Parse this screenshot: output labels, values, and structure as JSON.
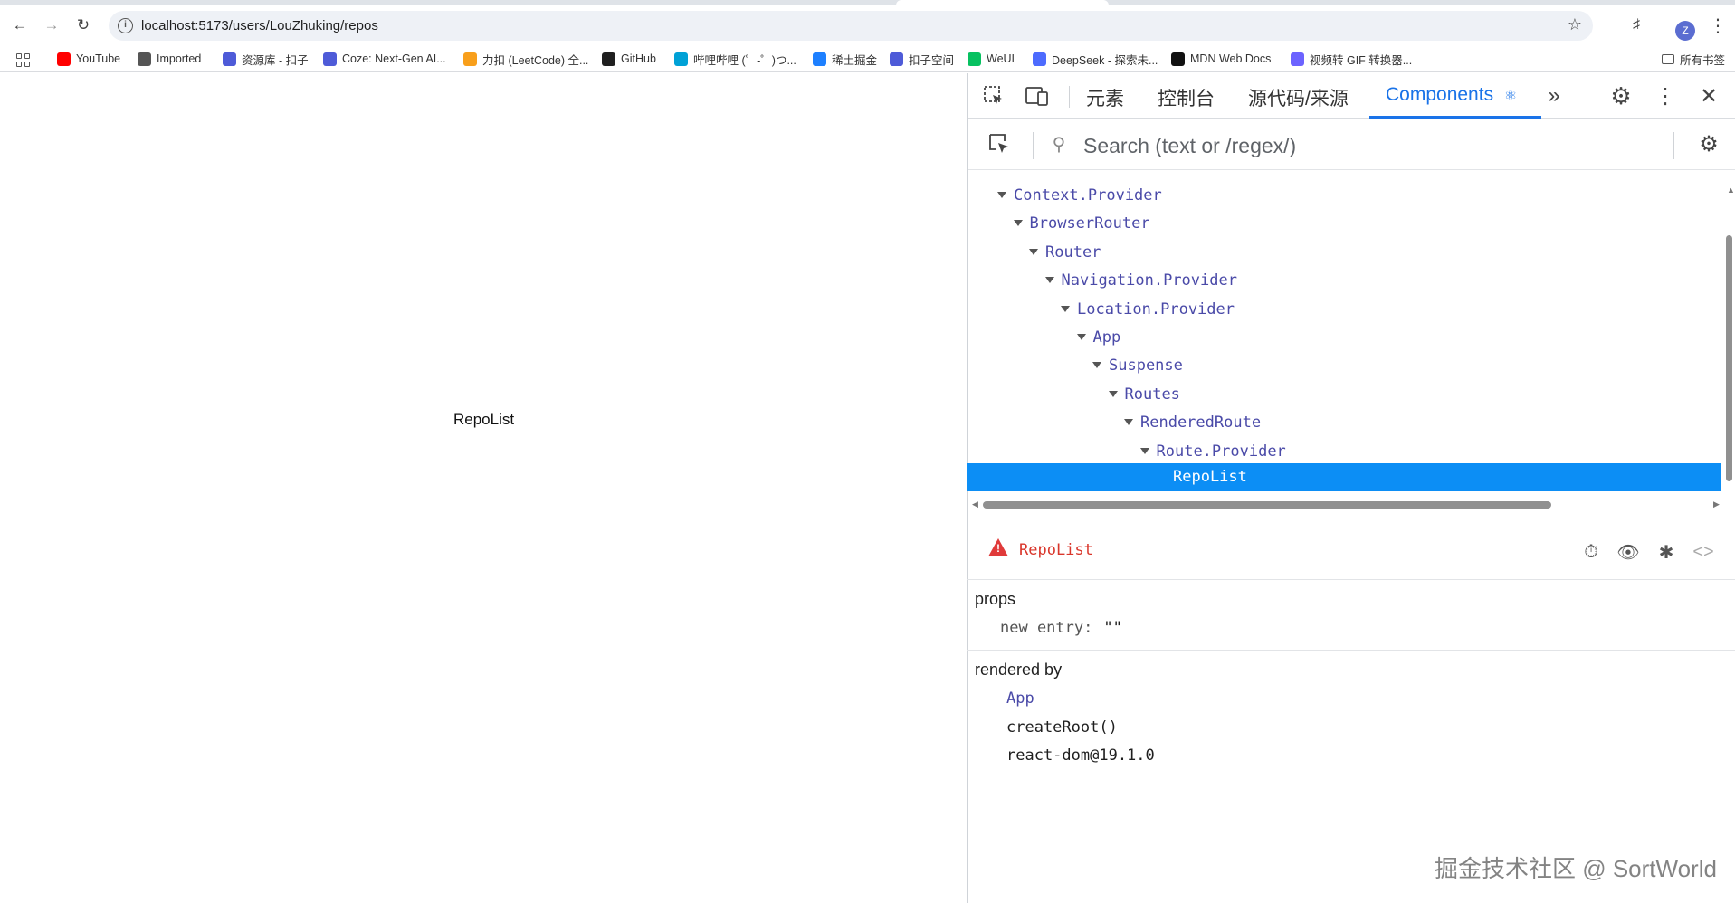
{
  "browser": {
    "url": "localhost:5173/users/LouZhuking/repos",
    "bookmarks": [
      {
        "label": "YouTube",
        "color": "#ff0000"
      },
      {
        "label": "Imported",
        "color": "#555555"
      },
      {
        "label": "资源库 - 扣子",
        "color": "#4e5bd8"
      },
      {
        "label": "Coze: Next-Gen AI...",
        "color": "#4e5bd8"
      },
      {
        "label": "力扣 (LeetCode) 全...",
        "color": "#f89f1b"
      },
      {
        "label": "GitHub",
        "color": "#1f1f1f"
      },
      {
        "label": "哔哩哔哩 (゜-゜)つ...",
        "color": "#00a1d6"
      },
      {
        "label": "稀土掘金",
        "color": "#1e80ff"
      },
      {
        "label": "扣子空间",
        "color": "#4e5bd8"
      },
      {
        "label": "WeUI",
        "color": "#07c160"
      },
      {
        "label": "DeepSeek - 探索未...",
        "color": "#4d6bfe"
      },
      {
        "label": "MDN Web Docs",
        "color": "#111111"
      },
      {
        "label": "视频转 GIF 转换器...",
        "color": "#6c63ff"
      }
    ],
    "all_bookmarks": "所有书签",
    "avatar_letter": "Z"
  },
  "page": {
    "text": "RepoList"
  },
  "devtools": {
    "tabs": [
      "元素",
      "控制台",
      "源代码/来源",
      "Components"
    ],
    "active_tab": "Components",
    "search_placeholder": "Search (text or /regex/)",
    "tree": [
      {
        "label": "Context.Provider",
        "depth": 0
      },
      {
        "label": "BrowserRouter",
        "depth": 1
      },
      {
        "label": "Router",
        "depth": 2
      },
      {
        "label": "Navigation.Provider",
        "depth": 3
      },
      {
        "label": "Location.Provider",
        "depth": 4
      },
      {
        "label": "App",
        "depth": 5
      },
      {
        "label": "Suspense",
        "depth": 6
      },
      {
        "label": "Routes",
        "depth": 7
      },
      {
        "label": "RenderedRoute",
        "depth": 8
      },
      {
        "label": "Route.Provider",
        "depth": 9
      }
    ],
    "selected_component": "RepoList",
    "inspector": {
      "component_name": "RepoList",
      "props_title": "props",
      "prop_key": "new entry:",
      "prop_value": "\"\"",
      "rendered_by_title": "rendered by",
      "rendered_by": [
        "App",
        "createRoot()",
        "react-dom@19.1.0"
      ]
    },
    "accent_color": "#1a73e8",
    "selection_color": "#0c8ef5"
  },
  "watermark": "掘金技术社区 @ SortWorld"
}
